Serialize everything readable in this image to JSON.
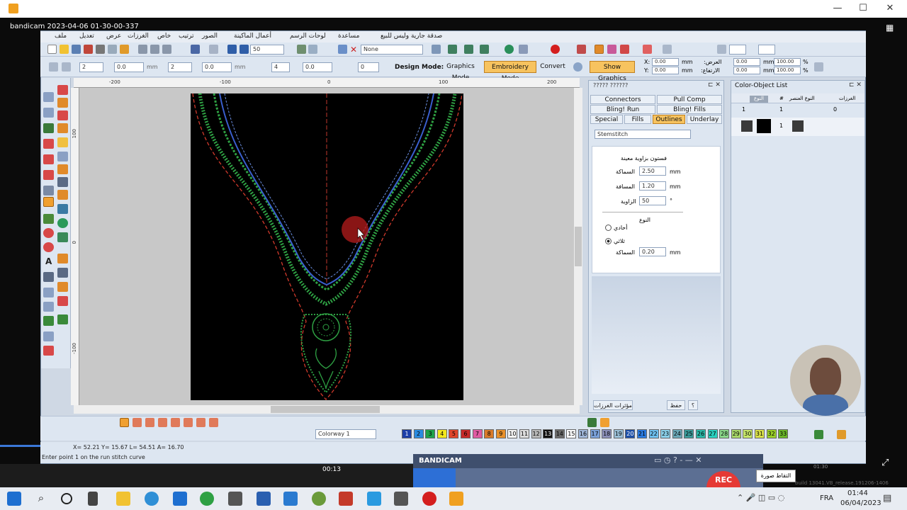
{
  "recorder": {
    "title": "bandicam 2023-04-06 01-30-00-337",
    "window_controls": [
      "—",
      "☐",
      "✕"
    ]
  },
  "menu": [
    "ملف",
    "تعديل",
    "عرض",
    "الغرزات",
    "خاص",
    "ترتيب",
    "الصور",
    "أعمال الماكينة",
    "لوحات الرسم",
    "مساعدة",
    "صدقة جارية وليس للبيع"
  ],
  "toolbar1": {
    "zoom_value": "50",
    "thread_value": "None"
  },
  "toolbar2": {
    "field_values": [
      "2",
      "0.0",
      "2",
      "0.0",
      "4",
      "0.0",
      "0"
    ],
    "unit": "mm",
    "design_mode_label": "Design Mode:",
    "graphics_mode": "Graphics Mode",
    "embroidery_mode": "Embroidery Mode",
    "convert": "Convert",
    "show_graphics": "Show Graphics",
    "x_label": "X:",
    "y_label": "Y:",
    "x_value": "0.00",
    "y_value": "0.00",
    "width_label": ":العرض",
    "height_label": ":الارتفاع",
    "width_value": "0.00",
    "height_value": "0.00",
    "pct1": "100.00",
    "pct2": "100.00",
    "pct_unit": "%"
  },
  "ruler_top": [
    "-200",
    "-100",
    "0",
    "100",
    "200"
  ],
  "ruler_left": [
    "100",
    "0",
    "-100"
  ],
  "props": {
    "title": "????? ??????",
    "tabs": [
      "Connectors",
      "Pull Comp",
      "Bling! Run",
      "Bling! Fills",
      "Special",
      "Fills",
      "Outlines",
      "Underlay"
    ],
    "stitch_type": "Stemstitch",
    "section_title": "فستون بزاوية معينة",
    "thickness_label": "السماكة",
    "thickness_value": "2.50",
    "spacing_label": "المسافة",
    "spacing_value": "1.20",
    "angle_label": "الزاوية",
    "angle_value": "50",
    "angle_unit": "°",
    "unit": "mm",
    "type_label": "النوع",
    "option_single": "أحادي",
    "option_triple": "ثلاثي",
    "thickness2_label": "السماكة",
    "thickness2_value": "0.20",
    "btn_effects": "مؤثرات الغرزات",
    "btn_save": "حفظ",
    "btn_help": "؟"
  },
  "color_list": {
    "title": "Color-Object List",
    "headers": [
      "الغرزات",
      "النوع العنصر",
      "#",
      "النوع"
    ],
    "row1": [
      "0",
      "1",
      "1"
    ],
    "row2_num": "1"
  },
  "bottom": {
    "colorway": "Colorway 1",
    "chips": [
      {
        "n": "1",
        "c": "#1c3fa8"
      },
      {
        "n": "2",
        "c": "#2a8be0"
      },
      {
        "n": "3",
        "c": "#1ea34a"
      },
      {
        "n": "4",
        "c": "#f3e81c"
      },
      {
        "n": "5",
        "c": "#e0452a"
      },
      {
        "n": "6",
        "c": "#c62a2a"
      },
      {
        "n": "7",
        "c": "#e05aa2"
      },
      {
        "n": "8",
        "c": "#d87a2a"
      },
      {
        "n": "9",
        "c": "#e8902a"
      },
      {
        "n": "10",
        "c": "#f4f4f4"
      },
      {
        "n": "11",
        "c": "#dcdcdc"
      },
      {
        "n": "12",
        "c": "#b8b8b8"
      },
      {
        "n": "13",
        "c": "#111111"
      },
      {
        "n": "14",
        "c": "#6a6a6a"
      },
      {
        "n": "15",
        "c": "#fafafa"
      },
      {
        "n": "16",
        "c": "#9fb6d8"
      },
      {
        "n": "17",
        "c": "#7aa0d8"
      },
      {
        "n": "18",
        "c": "#8a8fb8"
      },
      {
        "n": "19",
        "c": "#9ac0d8"
      },
      {
        "n": "20",
        "c": "#1c4fa8"
      },
      {
        "n": "21",
        "c": "#2a7ae0"
      },
      {
        "n": "22",
        "c": "#6ec0f0"
      },
      {
        "n": "23",
        "c": "#8ad0ea"
      },
      {
        "n": "24",
        "c": "#6aa8b8"
      },
      {
        "n": "25",
        "c": "#3a9a9a"
      },
      {
        "n": "26",
        "c": "#2ab8a8"
      },
      {
        "n": "27",
        "c": "#2ad0c0"
      },
      {
        "n": "28",
        "c": "#8ad88a"
      },
      {
        "n": "29",
        "c": "#a8d86a"
      },
      {
        "n": "30",
        "c": "#c8e86a"
      },
      {
        "n": "31",
        "c": "#d8e04a"
      },
      {
        "n": "32",
        "c": "#9ad02a"
      },
      {
        "n": "33",
        "c": "#6ab82a"
      }
    ]
  },
  "status": {
    "coords": "X= 52.21 Y= 15.67 L= 54.51 A= 16.70",
    "prompt": "Enter point 1 on the run stitch curve"
  },
  "bandicam": {
    "brand": "BANDICAM",
    "timer": "00:13",
    "rec": "REC",
    "time_right": "01:30",
    "tooltip": "التقاط صورة",
    "build": "build 13041.VB_release.191206-1406"
  },
  "taskbar": {
    "lang": "FRA",
    "time": "01:44",
    "date": "06/04/2023"
  }
}
